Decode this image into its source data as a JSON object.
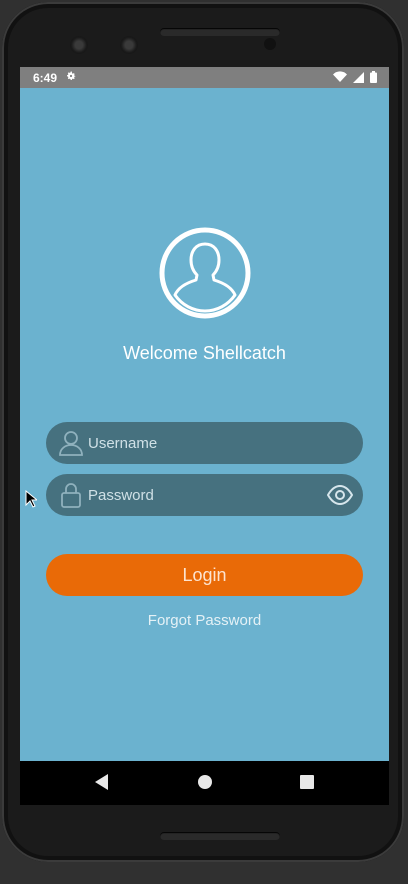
{
  "status_bar": {
    "time": "6:49",
    "settings_icon": "gear-icon",
    "wifi_icon": "wifi-icon",
    "signal_icon": "signal-icon",
    "battery_icon": "battery-icon"
  },
  "login": {
    "avatar_icon": "user-avatar-icon",
    "welcome_text": "Welcome Shellcatch",
    "username": {
      "placeholder": "Username",
      "value": "",
      "icon": "person-icon"
    },
    "password": {
      "placeholder": "Password",
      "value": "",
      "icon": "lock-icon",
      "toggle_icon": "eye-icon"
    },
    "login_label": "Login",
    "forgot_label": "Forgot Password"
  },
  "nav_bar": {
    "back_icon": "back-triangle-icon",
    "home_icon": "home-circle-icon",
    "recent_icon": "recent-square-icon"
  },
  "colors": {
    "screen_bg": "#6bb2cf",
    "field_bg": "#46717f",
    "accent": "#e96a07"
  }
}
